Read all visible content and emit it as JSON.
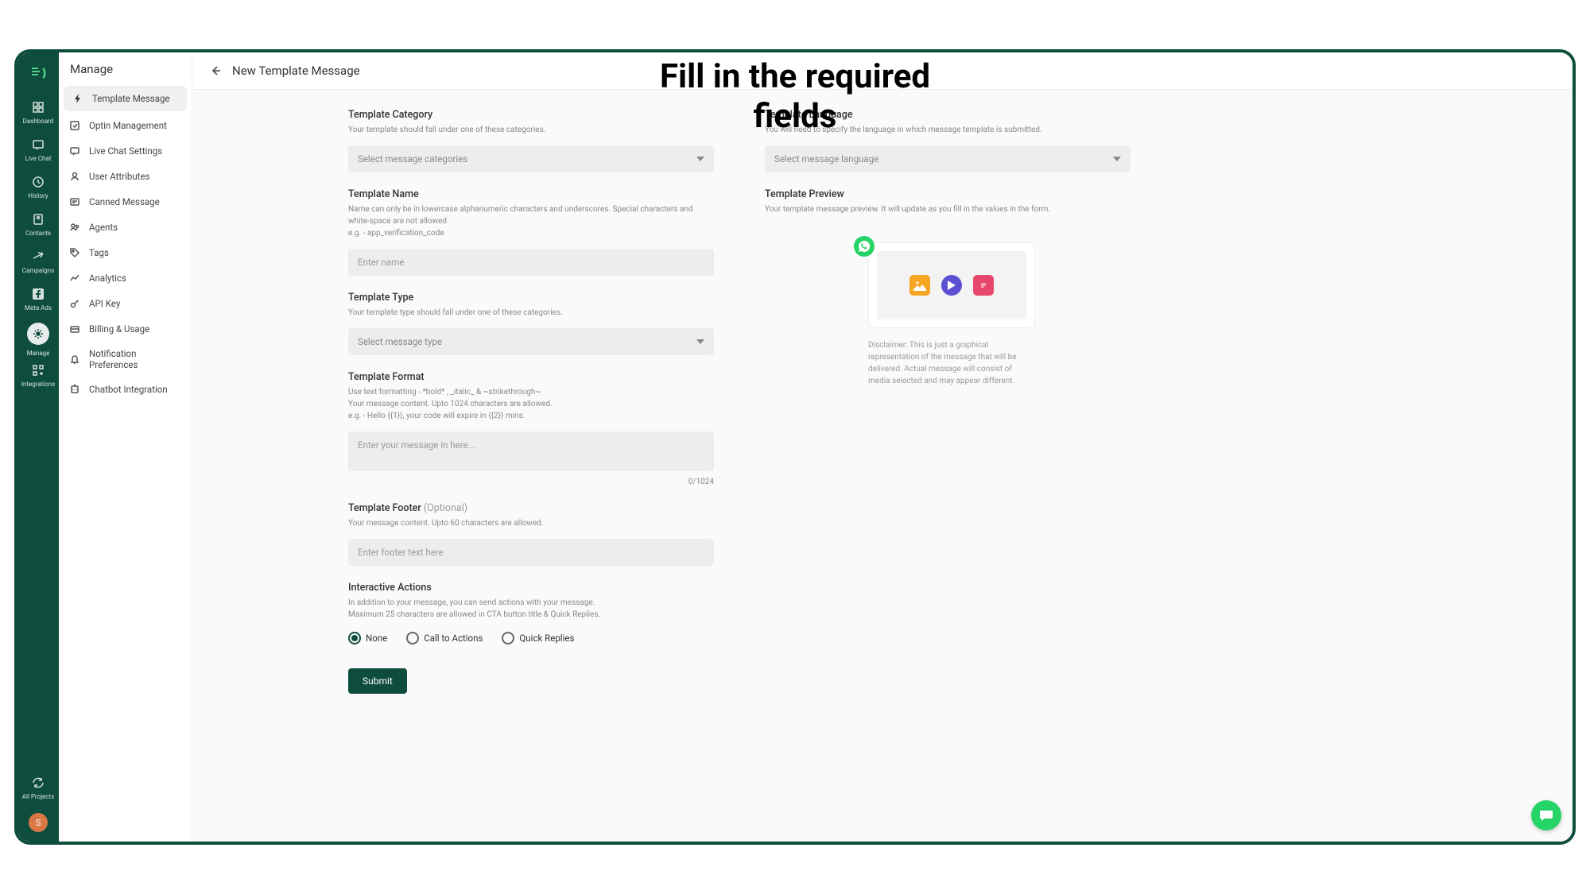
{
  "overlay_title": "Fill in the required\nfields",
  "rail": {
    "items": [
      {
        "label": "Dashboard",
        "name": "dashboard"
      },
      {
        "label": "Live Chat",
        "name": "live-chat"
      },
      {
        "label": "History",
        "name": "history"
      },
      {
        "label": "Contacts",
        "name": "contacts"
      },
      {
        "label": "Campaigns",
        "name": "campaigns"
      },
      {
        "label": "Meta Ads",
        "name": "meta-ads"
      },
      {
        "label": "Manage",
        "name": "manage",
        "active": true
      },
      {
        "label": "Integrations",
        "name": "integrations"
      }
    ],
    "all_projects": "All Projects",
    "avatar": "S"
  },
  "sidebar": {
    "title": "Manage",
    "items": [
      {
        "label": "Template Message",
        "name": "template-message",
        "active": true
      },
      {
        "label": "Optin Management",
        "name": "optin-management"
      },
      {
        "label": "Live Chat Settings",
        "name": "live-chat-settings"
      },
      {
        "label": "User Attributes",
        "name": "user-attributes"
      },
      {
        "label": "Canned Message",
        "name": "canned-message"
      },
      {
        "label": "Agents",
        "name": "agents"
      },
      {
        "label": "Tags",
        "name": "tags"
      },
      {
        "label": "Analytics",
        "name": "analytics"
      },
      {
        "label": "API Key",
        "name": "api-key"
      },
      {
        "label": "Billing & Usage",
        "name": "billing-usage"
      },
      {
        "label": "Notification Preferences",
        "name": "notification-preferences"
      },
      {
        "label": "Chatbot Integration",
        "name": "chatbot-integration"
      }
    ]
  },
  "header": {
    "title": "New Template Message"
  },
  "form": {
    "category": {
      "label": "Template Category",
      "help": "Your template should fall under one of these categories.",
      "placeholder": "Select message categories"
    },
    "language": {
      "label": "Template Language",
      "help": "You will need to specify the language in which message template is submitted.",
      "placeholder": "Select message language"
    },
    "name": {
      "label": "Template Name",
      "help": "Name can only be in lowercase alphanumeric characters and underscores. Special characters and white-space are not allowed\ne.g. - app_verification_code",
      "placeholder": "Enter name"
    },
    "type": {
      "label": "Template Type",
      "help": "Your template type should fall under one of these categories.",
      "placeholder": "Select message type"
    },
    "format": {
      "label": "Template Format",
      "help": "Use text formatting - *bold* , _italic_ & ~strikethrough~\nYour message content. Upto 1024 characters are allowed.\ne.g. - Hello {{1}}, your code will expire in {{2}} mins.",
      "placeholder": "Enter your message in here...",
      "count": "0/1024"
    },
    "footer": {
      "label": "Template Footer ",
      "optional": "(Optional)",
      "help": "Your message content. Upto 60 characters are allowed.",
      "placeholder": "Enter footer text here"
    },
    "actions": {
      "label": "Interactive Actions",
      "help": "In addition to your message, you can send actions with your message.\nMaximum 25 characters are allowed in CTA button title & Quick Replies.",
      "options": [
        {
          "label": "None",
          "checked": true
        },
        {
          "label": "Call to Actions",
          "checked": false
        },
        {
          "label": "Quick Replies",
          "checked": false
        }
      ]
    },
    "submit": "Submit"
  },
  "preview": {
    "label": "Template Preview",
    "help": "Your template message preview. It will update as you fill in the values in the form.",
    "disclaimer": "Disclaimer: This is just a graphical representation of the message that will be delivered. Actual message will consist of media selected and may appear different."
  }
}
